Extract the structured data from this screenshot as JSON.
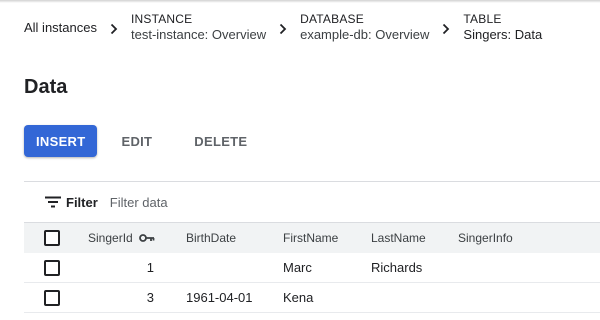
{
  "breadcrumb": {
    "root_label": "All instances",
    "items": [
      {
        "type": "INSTANCE",
        "name": "test-instance: Overview"
      },
      {
        "type": "DATABASE",
        "name": "example-db: Overview"
      },
      {
        "type": "TABLE",
        "name": "Singers: Data"
      }
    ]
  },
  "page": {
    "title": "Data"
  },
  "toolbar": {
    "insert_label": "INSERT",
    "edit_label": "EDIT",
    "delete_label": "DELETE"
  },
  "filter": {
    "label": "Filter",
    "placeholder": "Filter data"
  },
  "table": {
    "columns": [
      "SingerId",
      "BirthDate",
      "FirstName",
      "LastName",
      "SingerInfo"
    ],
    "rows": [
      {
        "SingerId": "1",
        "BirthDate": "",
        "FirstName": "Marc",
        "LastName": "Richards",
        "SingerInfo": ""
      },
      {
        "SingerId": "3",
        "BirthDate": "1961-04-01",
        "FirstName": "Kena",
        "LastName": "",
        "SingerInfo": ""
      }
    ]
  },
  "colors": {
    "primary": "#3367d6",
    "header_bg": "#f1f3f4",
    "divider": "#dadce0"
  },
  "icons": {
    "chevron": "chevron-right-icon",
    "filter": "filter-icon",
    "key": "key-icon"
  }
}
